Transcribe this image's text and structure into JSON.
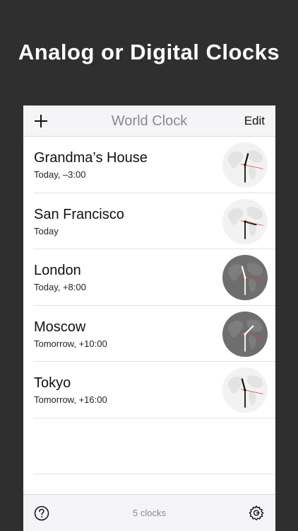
{
  "headline": "Analog or Digital Clocks",
  "navbar": {
    "add_icon": "plus-icon",
    "title": "World Clock",
    "edit_label": "Edit"
  },
  "clocks": [
    {
      "city": "Grandma’s House",
      "offset": "Today, –3:00",
      "theme": "light",
      "time": {
        "hour": 12.0,
        "minute": 30,
        "second": 17
      }
    },
    {
      "city": "San Francisco",
      "offset": "Today",
      "theme": "light",
      "time": {
        "hour": 3.0,
        "minute": 30,
        "second": 17
      }
    },
    {
      "city": "London",
      "offset": "Today, +8:00",
      "theme": "dark",
      "time": {
        "hour": 11.0,
        "minute": 30,
        "second": 17
      }
    },
    {
      "city": "Moscow",
      "offset": "Tomorrow, +10:00",
      "theme": "dark",
      "time": {
        "hour": 1.0,
        "minute": 30,
        "second": 17
      }
    },
    {
      "city": "Tokyo",
      "offset": "Tomorrow, +16:00",
      "theme": "light",
      "time": {
        "hour": 11.0,
        "minute": 30,
        "second": 17
      }
    }
  ],
  "toolbar": {
    "help_icon": "question-icon",
    "count_label": "5 clocks",
    "settings_icon": "gear-icon"
  },
  "colors": {
    "background": "#2f2f2f",
    "second_hand": "#e0443b",
    "light_face": "#f2f2f2",
    "dark_face": "#6e6e6e"
  }
}
